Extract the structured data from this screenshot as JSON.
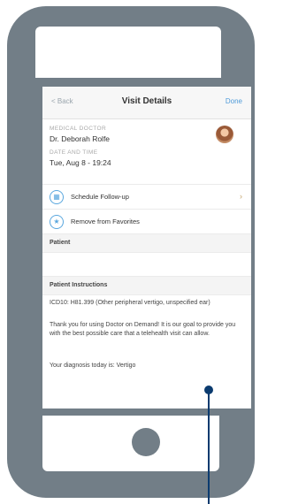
{
  "nav": {
    "back": "< Back",
    "title": "Visit Details",
    "done": "Done"
  },
  "doctor": {
    "role_label": "MEDICAL DOCTOR",
    "name": "Dr. Deborah Rolfe",
    "datetime_label": "DATE AND TIME",
    "datetime": "Tue, Aug 8 - 19:24"
  },
  "actions": [
    {
      "label": "Schedule Follow-up",
      "icon": "calendar-icon"
    },
    {
      "label": "Remove from Favorites",
      "icon": "star-icon"
    }
  ],
  "sections": {
    "patient": "Patient",
    "instructions": "Patient Instructions"
  },
  "instructions": {
    "icd": "ICD10: H81.399 (Other peripheral vertigo, unspecified ear)",
    "thanks": "Thank you for using Doctor on Demand! It is our goal to provide you with the best possible care that a telehealth visit can allow.",
    "diagnosis": "Your diagnosis today is: Vertigo"
  },
  "colors": {
    "frame": "#727e87",
    "accent": "#4f9bd9",
    "pointer": "#0b3b6f"
  }
}
